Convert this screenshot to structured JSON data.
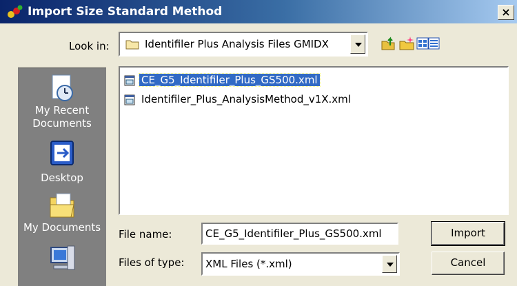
{
  "window": {
    "title": "Import Size Standard Method",
    "close_glyph": "×"
  },
  "look_in": {
    "label": "Look in:",
    "value": "Identifiler Plus Analysis Files GMIDX"
  },
  "toolbar": {
    "icons": [
      "up-folder-icon",
      "new-folder-icon",
      "view-menu-icon"
    ]
  },
  "places": [
    {
      "label_lines": [
        "My Recent",
        "Documents"
      ],
      "icon": "recent-documents-icon"
    },
    {
      "label_lines": [
        "Desktop"
      ],
      "icon": "desktop-icon"
    },
    {
      "label_lines": [
        "My Documents"
      ],
      "icon": "my-documents-icon"
    },
    {
      "label_lines": [
        ""
      ],
      "icon": "my-computer-icon"
    }
  ],
  "files": [
    {
      "name": "CE_G5_Identifiler_Plus_GS500.xml",
      "selected": true,
      "icon": "xml-file-icon"
    },
    {
      "name": "Identifiler_Plus_AnalysisMethod_v1X.xml",
      "selected": false,
      "icon": "xml-file-icon"
    }
  ],
  "file_name": {
    "label": "File name:",
    "value": "CE_G5_Identifiler_Plus_GS500.xml"
  },
  "file_type": {
    "label": "Files of type:",
    "value": "XML Files (*.xml)"
  },
  "buttons": {
    "import": "Import",
    "cancel": "Cancel"
  },
  "colors": {
    "title_start": "#0a246a",
    "title_end": "#a6caf0",
    "selection": "#316ac5",
    "dialog_bg": "#ece9d8",
    "places_bg": "#808080"
  }
}
